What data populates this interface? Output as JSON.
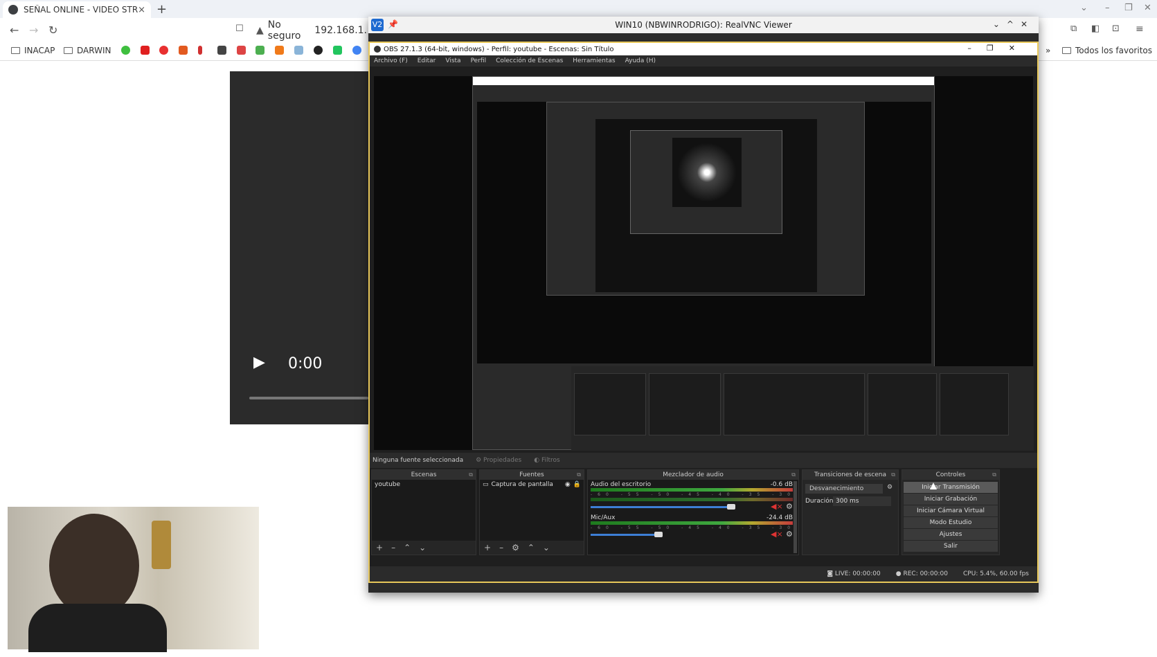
{
  "browser": {
    "tab_title": "SEÑAL ONLINE - VIDEO STRE",
    "tab_close": "×",
    "new_tab": "+",
    "back": "←",
    "forward": "→",
    "reload": "↻",
    "security_warning": "No seguro",
    "url": "192.168.1.",
    "bookmarks": [
      "INACAP",
      "DARWIN"
    ],
    "all_bookmarks": "Todos los favoritos",
    "more": "»"
  },
  "video_player": {
    "time": "0:00"
  },
  "vnc_window": {
    "title": "WIN10 (NBWINRODRIGO): RealVNC Viewer",
    "logo": "V2"
  },
  "obs": {
    "title": "OBS 27.1.3 (64-bit, windows) - Perfil: youtube - Escenas: Sin Título",
    "menu": [
      "Archivo (F)",
      "Editar",
      "Vista",
      "Perfil",
      "Colección de Escenas",
      "Herramientas",
      "Ayuda (H)"
    ],
    "no_source": "Ninguna fuente seleccionada",
    "properties": "Propiedades",
    "filters": "Filtros",
    "docks": {
      "scenes": {
        "title": "Escenas",
        "items": [
          "youtube"
        ]
      },
      "sources": {
        "title": "Fuentes",
        "items": [
          "Captura de pantalla"
        ]
      },
      "mixer": {
        "title": "Mezclador de audio",
        "channels": [
          {
            "name": "Audio del escritorio",
            "db": "-0.6 dB",
            "volume": 0.81
          },
          {
            "name": "Mic/Aux",
            "db": "-24.4 dB",
            "volume": 0.39
          }
        ]
      },
      "transitions": {
        "title": "Transiciones de escena",
        "selected": "Desvanecimiento",
        "duration_label": "Duración",
        "duration_value": "300 ms"
      },
      "controls": {
        "title": "Controles",
        "buttons": [
          "Iniciar Transmisión",
          "Iniciar Grabación",
          "Iniciar Cámara Virtual",
          "Modo Estudio",
          "Ajustes",
          "Salir"
        ]
      }
    },
    "status": {
      "live": "LIVE: 00:00:00",
      "rec": "REC: 00:00:00",
      "cpu": "CPU: 5.4%, 60.00 fps"
    }
  },
  "colors": {
    "accent_border": "#e8c85a",
    "meter_green": "#3fa83f",
    "meter_red": "#c43b3b",
    "slider_blue": "#3d7fd6"
  }
}
